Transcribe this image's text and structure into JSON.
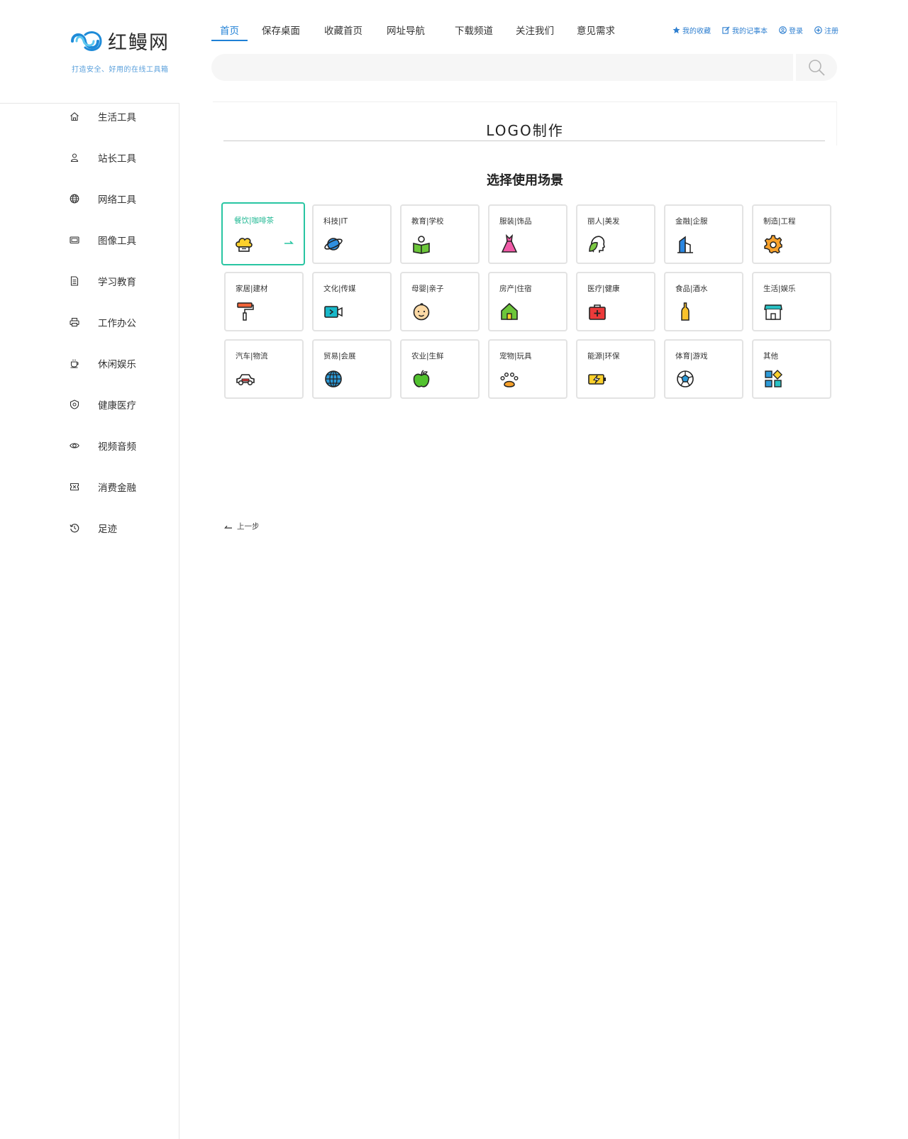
{
  "brand": {
    "name": "红鳗网",
    "slogan": "打造安全、好用的在线工具箱"
  },
  "nav": {
    "items": [
      {
        "label": "首页"
      },
      {
        "label": "保存桌面"
      },
      {
        "label": "收藏首页"
      },
      {
        "label": "网址导航"
      },
      {
        "label": "下载频道"
      },
      {
        "label": "关注我们"
      },
      {
        "label": "意见需求"
      }
    ]
  },
  "user_links": {
    "favorites": "我的收藏",
    "notebook": "我的记事本",
    "login": "登录",
    "register": "注册"
  },
  "search": {
    "value": "",
    "placeholder": ""
  },
  "sidebar": {
    "items": [
      {
        "label": "生活工具",
        "icon": "home-icon"
      },
      {
        "label": "站长工具",
        "icon": "user-icon"
      },
      {
        "label": "网络工具",
        "icon": "globe-icon"
      },
      {
        "label": "图像工具",
        "icon": "image-icon"
      },
      {
        "label": "学习教育",
        "icon": "document-icon"
      },
      {
        "label": "工作办公",
        "icon": "printer-icon"
      },
      {
        "label": "休闲娱乐",
        "icon": "coffee-icon"
      },
      {
        "label": "健康医疗",
        "icon": "shield-icon"
      },
      {
        "label": "视频音频",
        "icon": "eye-icon"
      },
      {
        "label": "消费金融",
        "icon": "ticket-icon"
      },
      {
        "label": "足迹",
        "icon": "history-icon"
      }
    ]
  },
  "main": {
    "title": "LOGO制作",
    "subtitle": "选择使用场景",
    "scenes": [
      {
        "label": "餐饮|咖啡茶",
        "icon": "chef-hat-icon",
        "selected": true
      },
      {
        "label": "科技|IT",
        "icon": "planet-icon"
      },
      {
        "label": "教育|学校",
        "icon": "reading-icon"
      },
      {
        "label": "服装|饰品",
        "icon": "dress-icon"
      },
      {
        "label": "丽人|美发",
        "icon": "beauty-head-icon"
      },
      {
        "label": "金融|企服",
        "icon": "building-icon"
      },
      {
        "label": "制造|工程",
        "icon": "gear-icon"
      },
      {
        "label": "家居|建材",
        "icon": "paint-roller-icon"
      },
      {
        "label": "文化|传媒",
        "icon": "video-camera-icon"
      },
      {
        "label": "母婴|亲子",
        "icon": "baby-face-icon"
      },
      {
        "label": "房产|住宿",
        "icon": "house-icon"
      },
      {
        "label": "医疗|健康",
        "icon": "medical-kit-icon"
      },
      {
        "label": "食品|酒水",
        "icon": "bottle-icon"
      },
      {
        "label": "生活|娱乐",
        "icon": "shop-icon"
      },
      {
        "label": "汽车|物流",
        "icon": "car-icon"
      },
      {
        "label": "贸易|会展",
        "icon": "globe-icon"
      },
      {
        "label": "农业|生鲜",
        "icon": "apple-icon"
      },
      {
        "label": "宠物|玩具",
        "icon": "paw-icon"
      },
      {
        "label": "能源|环保",
        "icon": "battery-icon"
      },
      {
        "label": "体育|游戏",
        "icon": "soccer-ball-icon"
      },
      {
        "label": "其他",
        "icon": "grid-icon"
      }
    ],
    "back_label": "上一步"
  },
  "colors": {
    "accent": "#1f80d6",
    "selected": "#28c5a2"
  }
}
